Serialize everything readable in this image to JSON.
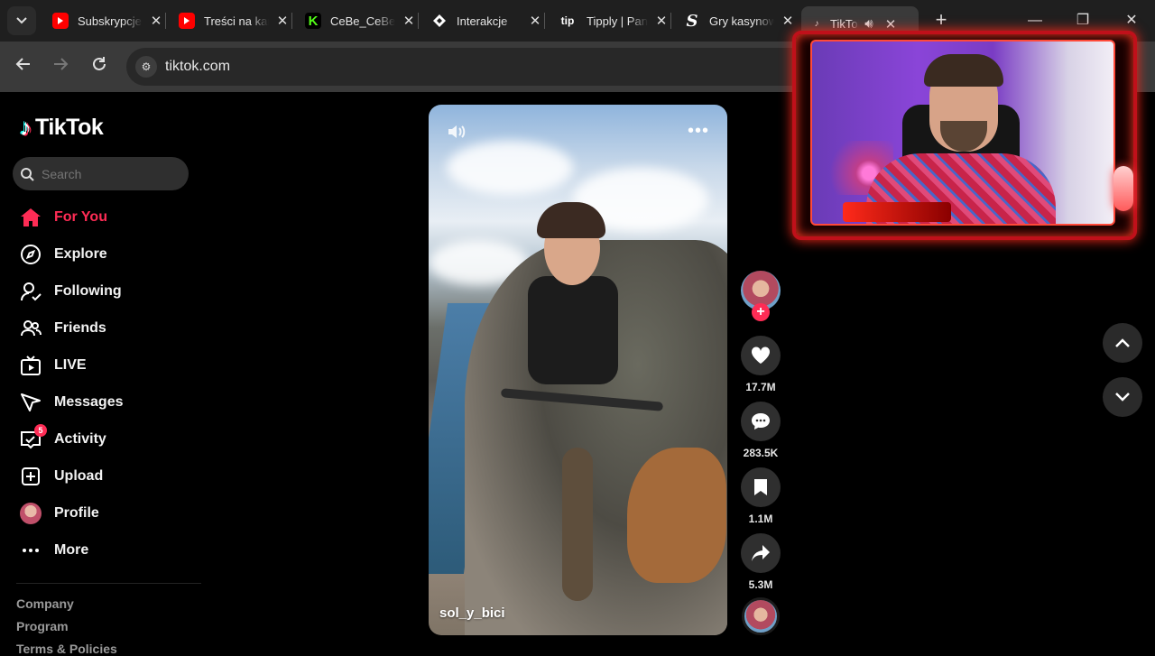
{
  "browser": {
    "tabs": [
      {
        "title": "Subskrypcje",
        "favicon": "youtube-icon",
        "color": "#ff0000"
      },
      {
        "title": "Treści na kanale",
        "favicon": "youtube-icon",
        "color": "#ff0000"
      },
      {
        "title": "CeBe_CeBe",
        "favicon": "kick-icon",
        "color": "#53fc18"
      },
      {
        "title": "Interakcje",
        "favicon": "diamond-icon",
        "color": "#ffffff"
      },
      {
        "title": "Tipply | Panel",
        "favicon": "tipply-icon",
        "color": "#ffffff"
      },
      {
        "title": "Gry kasynowe",
        "favicon": "s-icon",
        "color": "#ffffff"
      },
      {
        "title": "TikTok",
        "favicon": "tiktok-icon",
        "color": "#ffffff",
        "active": true
      }
    ],
    "url": "tiktok.com"
  },
  "sidebar": {
    "logo_text": "TikTok",
    "search_placeholder": "Search",
    "nav": [
      {
        "label": "For You",
        "icon": "home-icon",
        "active": true
      },
      {
        "label": "Explore",
        "icon": "compass-icon"
      },
      {
        "label": "Following",
        "icon": "following-icon"
      },
      {
        "label": "Friends",
        "icon": "friends-icon"
      },
      {
        "label": "LIVE",
        "icon": "live-icon"
      },
      {
        "label": "Messages",
        "icon": "messages-icon"
      },
      {
        "label": "Activity",
        "icon": "activity-icon",
        "badge": "5"
      },
      {
        "label": "Upload",
        "icon": "upload-icon"
      },
      {
        "label": "Profile",
        "icon": "profile-avatar"
      },
      {
        "label": "More",
        "icon": "more-icon"
      }
    ],
    "footer": [
      "Company",
      "Program",
      "Terms & Policies"
    ]
  },
  "video": {
    "author": "sol_y_bici",
    "more_glyph": "•••"
  },
  "actions": {
    "likes": "17.7M",
    "comments": "283.5K",
    "saves": "1.1M",
    "shares": "5.3M",
    "follow_glyph": "+"
  },
  "colors": {
    "accent": "#fe2c55",
    "background": "#000000",
    "webcam_frame": "#c0101a"
  }
}
